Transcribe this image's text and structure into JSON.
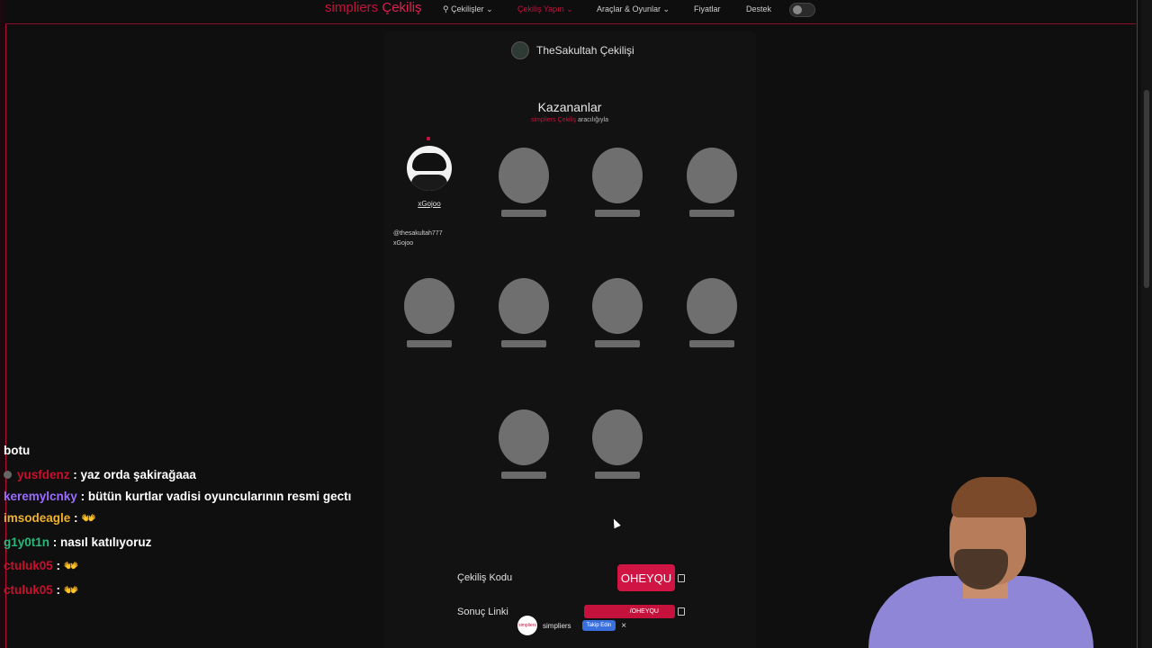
{
  "nav": {
    "brand_part1": "simpliers",
    "brand_part2": "Çekiliş",
    "items": [
      {
        "label": "Çekilişler ⌄"
      },
      {
        "label": "Çekiliş Yapın ⌄"
      },
      {
        "label": "Araçlar & Oyunlar ⌄"
      },
      {
        "label": "Fiyatlar"
      },
      {
        "label": "Destek"
      }
    ]
  },
  "giveaway": {
    "title": "TheSakultah Çekilişi",
    "winners_heading": "Kazananlar",
    "via_brand": "simpliers Çekiliş",
    "via_suffix": " aracılığıyla",
    "winner_name": "xGojoo",
    "mention_handle": "@thesakultah777",
    "mention_text": "xGojoo",
    "code_label": "Çekiliş Kodu",
    "code_value": "OHEYQU",
    "link_label": "Sonuç Linki",
    "link_value": "/OHEYQU"
  },
  "popup": {
    "logo": "simpliers",
    "name": "simpliers",
    "follow": "Takip Edin",
    "close": "×"
  },
  "chat": [
    {
      "user": "",
      "text": "botu"
    },
    {
      "user": "yusfdenz",
      "text": ": yaz orda şakirağaaa"
    },
    {
      "user": "keremylcnky",
      "text": ": bütün kurtlar vadisi oyuncularının resmi gectı"
    },
    {
      "user": "imsodeagle",
      "text": ": 👐"
    },
    {
      "user": "g1y0t1n",
      "text": ": nasıl katılıyoruz"
    },
    {
      "user": "ctuluk05",
      "text": ": 👐"
    },
    {
      "user": "ctuluk05",
      "text": ": 👐"
    }
  ],
  "colors": {
    "accent": "#c4123d",
    "background": "#0f0f0f",
    "placeholder": "#6f6f6f"
  }
}
